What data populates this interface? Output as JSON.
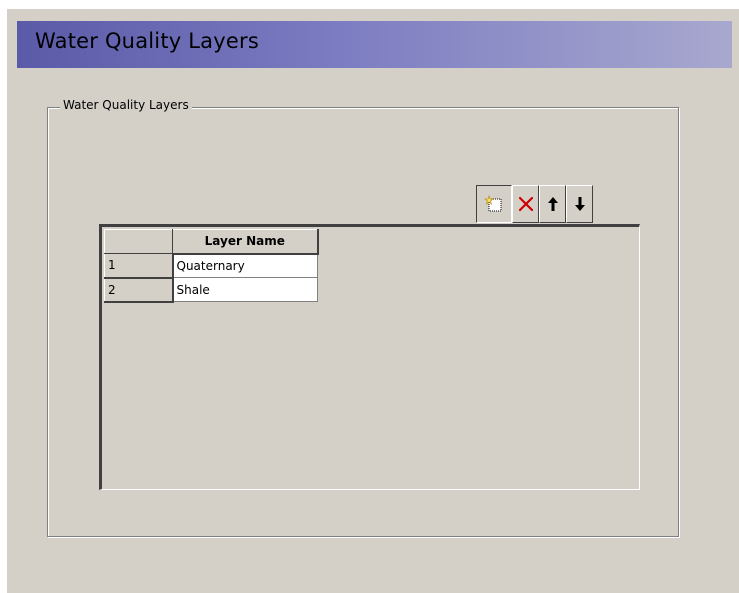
{
  "window": {
    "title": "Water Quality Layers"
  },
  "group": {
    "legend": "Water Quality Layers"
  },
  "toolbar": {
    "buttons": [
      {
        "name": "add-layer-button",
        "icon": "new-row-icon"
      },
      {
        "name": "delete-layer-button",
        "icon": "delete-x-icon"
      },
      {
        "name": "move-up-button",
        "icon": "arrow-up-icon"
      },
      {
        "name": "move-down-button",
        "icon": "arrow-down-icon"
      }
    ]
  },
  "grid": {
    "columns": [
      "Layer Name"
    ],
    "rows": [
      {
        "index": "1",
        "layer_name": "Quaternary"
      },
      {
        "index": "2",
        "layer_name": "Shale"
      }
    ]
  },
  "colors": {
    "title_gradient_start": "#5a5aa8",
    "title_gradient_end": "#a8a8cf",
    "window_bg": "#d4d0c8",
    "delete_red": "#cc0000"
  }
}
